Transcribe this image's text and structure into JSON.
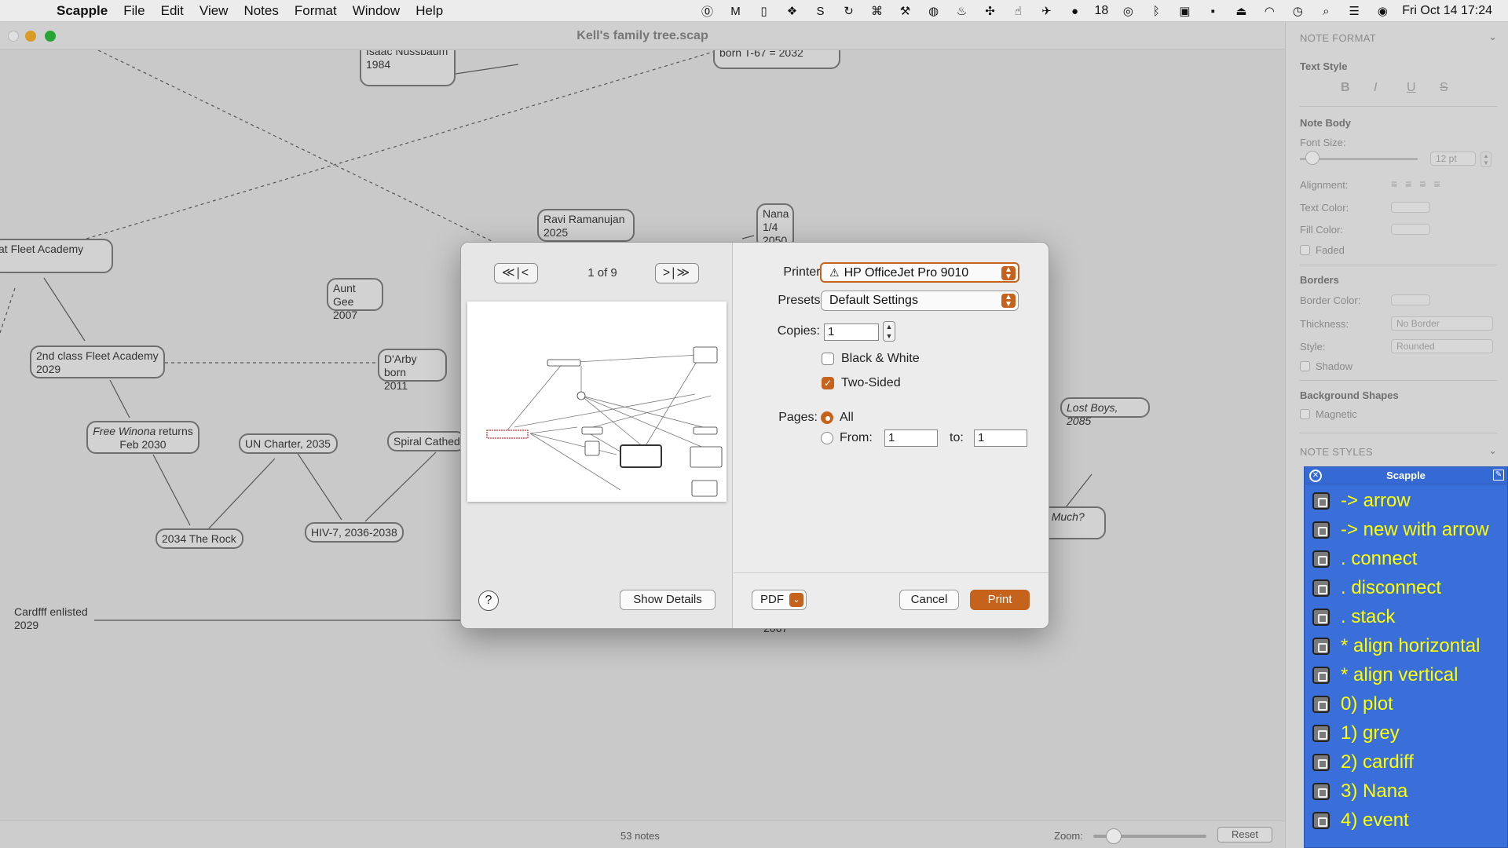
{
  "menubar": {
    "app_name": "Scapple",
    "items": [
      "File",
      "Edit",
      "View",
      "Notes",
      "Format",
      "Window",
      "Help"
    ],
    "badge_count": "18",
    "clock": "Fri Oct 14  17:24"
  },
  "window": {
    "title": "Kell's family tree.scap",
    "status_count": "53 notes",
    "zoom_label": "Zoom:",
    "reset_label": "Reset"
  },
  "canvas": {
    "notes": {
      "isaac": "Isaac Nussbaum\n1984",
      "born_t67": "born T-67 = 2032",
      "fleet_academy": "at Fleet Academy",
      "ravi": "Ravi Ramanujan\n2025",
      "nana": "Nana\n1/4\n2050",
      "aunt_gee": "Aunt Gee\n2007",
      "second_class": "2nd class Fleet Academy\n2029",
      "darby": "D'Arby born\n2011",
      "free_winona_italic": "Free Winona",
      "free_winona_rest": " returns\nFeb 2030",
      "un_charter": "UN Charter, 2035",
      "spiral": "Spiral Cathedral",
      "lost_boys": "Lost Boys, 2085",
      "rock": "2034 The Rock",
      "hiv7": "HIV-7, 2036-2038",
      "too_much": "Too Much?",
      "cardiff": "Cardfff enlisted\n2029",
      "year_2067": "2067"
    }
  },
  "inspector": {
    "note_format": "NOTE FORMAT",
    "text_style": "Text Style",
    "bold": "B",
    "italic": "I",
    "underline": "U",
    "strike": "S",
    "note_body": "Note Body",
    "font_size": "Font Size:",
    "font_size_value": "12 pt",
    "alignment": "Alignment:",
    "text_color": "Text Color:",
    "fill_color": "Fill Color:",
    "faded": "Faded",
    "borders": "Borders",
    "border_color": "Border Color:",
    "thickness": "Thickness:",
    "thickness_value": "No Border",
    "style": "Style:",
    "style_value": "Rounded",
    "shadow": "Shadow",
    "background_shapes": "Background Shapes",
    "magnetic": "Magnetic",
    "note_styles": "NOTE STYLES"
  },
  "styles_panel": {
    "title": "Scapple",
    "items": [
      "-> arrow",
      "-> new with arrow",
      ". connect",
      ". disconnect",
      ". stack",
      "* align horizontal",
      "* align vertical",
      "0) plot",
      "1) grey",
      "2) cardiff",
      "3) Nana",
      "4) event"
    ]
  },
  "print_dialog": {
    "page_indicator": "1 of 9",
    "first_prev": "≪|<",
    "next_last": ">|≫",
    "help": "?",
    "show_details": "Show Details",
    "printer_label": "Printer:",
    "printer_value": "HP OfficeJet Pro 9010",
    "presets_label": "Presets:",
    "presets_value": "Default Settings",
    "copies_label": "Copies:",
    "copies_value": "1",
    "black_white": "Black & White",
    "two_sided": "Two-Sided",
    "pages_label": "Pages:",
    "all_label": "All",
    "from_label": "From:",
    "from_value": "1",
    "to_label": "to:",
    "to_value": "1",
    "pdf": "PDF",
    "cancel": "Cancel",
    "print": "Print",
    "accent": "#c5621c"
  }
}
